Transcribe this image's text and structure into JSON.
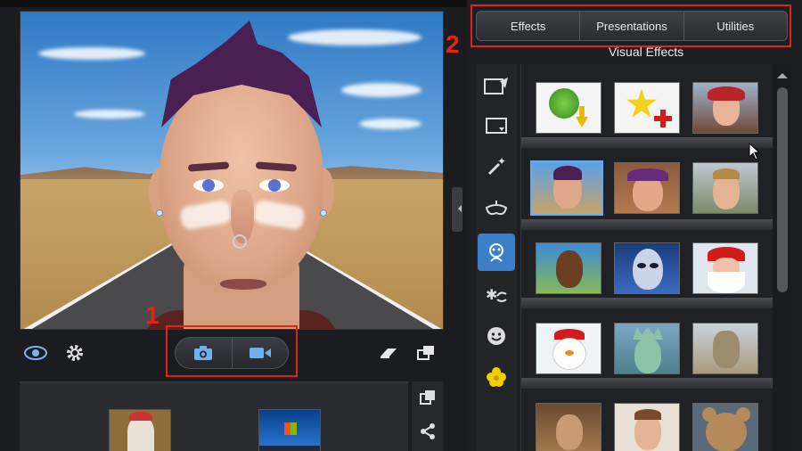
{
  "tabs": [
    "Effects",
    "Presentations",
    "Utilities"
  ],
  "section_title": "Visual Effects",
  "annotations": {
    "badge_1": "1",
    "badge_2": "2"
  },
  "icons": {
    "left_toolbar": [
      "eye-icon",
      "gear-icon",
      "camera-icon",
      "video-camera-icon",
      "eraser-icon",
      "window-switch-icon"
    ],
    "categories": [
      "scene-icon",
      "frame-icon",
      "magic-wand-icon",
      "mask-icon",
      "avatar-icon",
      "particles-icon",
      "smiley-icon",
      "flower-icon"
    ],
    "gallery_side": [
      "copy-icon",
      "share-icon"
    ]
  },
  "colors": {
    "annotation": "#e4221c",
    "active_category": "#3b7fc8",
    "selected_effect": "#69a8f0"
  },
  "effects_rows": 5,
  "active_category_index": 4,
  "selected_effect": "row-2-item-1"
}
